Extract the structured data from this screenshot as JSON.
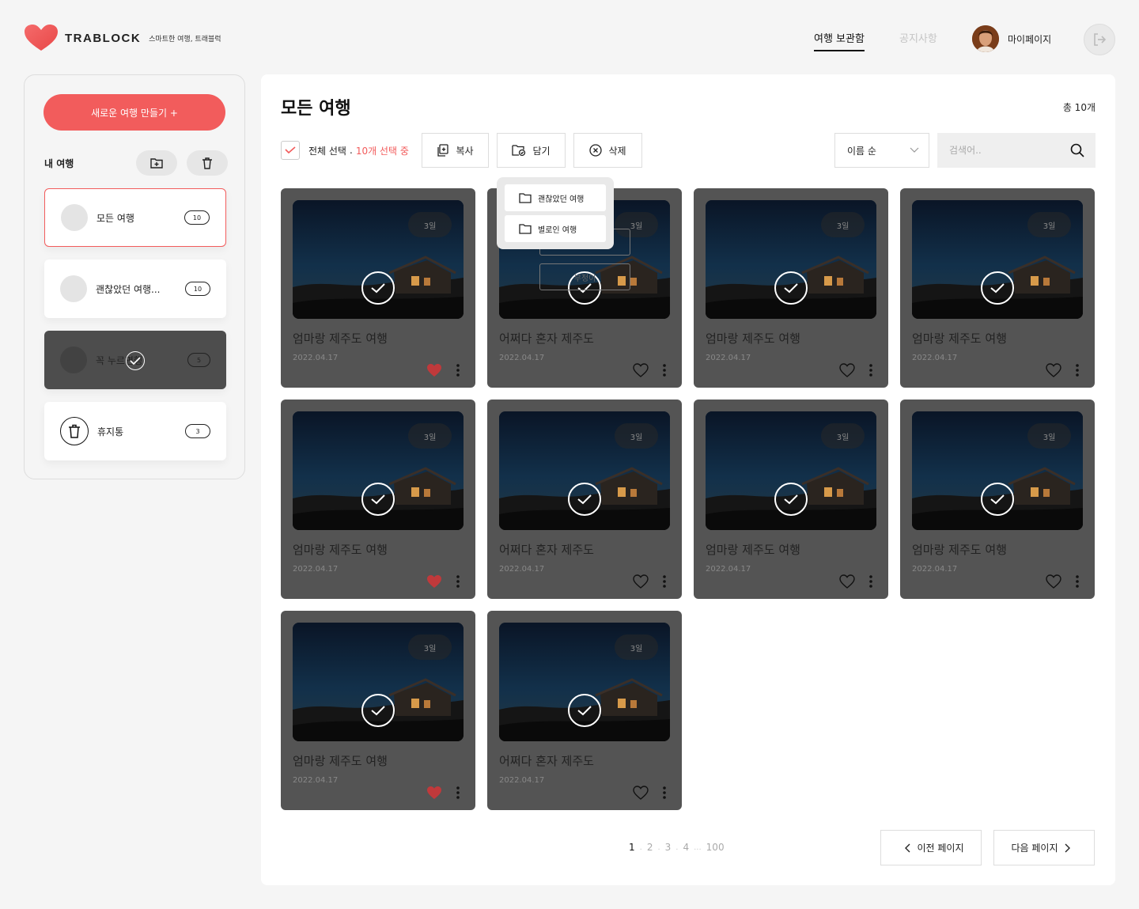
{
  "brand": {
    "name": "TRABLOCK",
    "tagline": "스마트한 여행, 트래블럭",
    "accent": "#f25c5c"
  },
  "header": {
    "nav_vault": "여행 보관함",
    "nav_notice": "공지사항",
    "mypage": "마이페이지"
  },
  "sidebar": {
    "new_trip": "새로운 여행 만들기 +",
    "my_trips": "내 여행",
    "folders": [
      {
        "name": "모든 여행",
        "count": "10"
      },
      {
        "name": "괜찮았던 여행...",
        "count": "10"
      },
      {
        "name": "꼭 누르면행",
        "count": "5"
      },
      {
        "name": "휴지통",
        "count": "3"
      }
    ]
  },
  "main": {
    "title": "모든 여행",
    "total": "총 10개",
    "select_all": "전체 선택",
    "dot": ".",
    "selected": "10개 선택 중",
    "copy": "복사",
    "save": "담기",
    "delete": "삭제",
    "sort": "이름 순",
    "search_placeholder": "검색어..",
    "dropdown": [
      "괜찮았던 여행",
      "별로인 여행"
    ],
    "ghost_label": "부정이"
  },
  "cards": [
    {
      "days": "3일",
      "title": "엄마랑 제주도 여행",
      "date": "2022.04.17",
      "liked": true
    },
    {
      "days": "3일",
      "title": "어쩌다 혼자 제주도",
      "date": "2022.04.17",
      "liked": false
    },
    {
      "days": "3일",
      "title": "엄마랑 제주도 여행",
      "date": "2022.04.17",
      "liked": false
    },
    {
      "days": "3일",
      "title": "엄마랑 제주도 여행",
      "date": "2022.04.17",
      "liked": false
    },
    {
      "days": "3일",
      "title": "엄마랑 제주도 여행",
      "date": "2022.04.17",
      "liked": true
    },
    {
      "days": "3일",
      "title": "어쩌다 혼자 제주도",
      "date": "2022.04.17",
      "liked": false
    },
    {
      "days": "3일",
      "title": "엄마랑 제주도 여행",
      "date": "2022.04.17",
      "liked": false
    },
    {
      "days": "3일",
      "title": "엄마랑 제주도 여행",
      "date": "2022.04.17",
      "liked": false
    },
    {
      "days": "3일",
      "title": "엄마랑 제주도 여행",
      "date": "2022.04.17",
      "liked": true
    },
    {
      "days": "3일",
      "title": "어쩌다 혼자 제주도",
      "date": "2022.04.17",
      "liked": false
    }
  ],
  "pagination": {
    "pages": [
      "1",
      "2",
      "3",
      "4",
      "...",
      "100"
    ],
    "prev": "이전 페이지",
    "next": "다음 페이지"
  },
  "colors": {
    "card_bg": "#545454",
    "heart_liked": "#c0393b"
  }
}
